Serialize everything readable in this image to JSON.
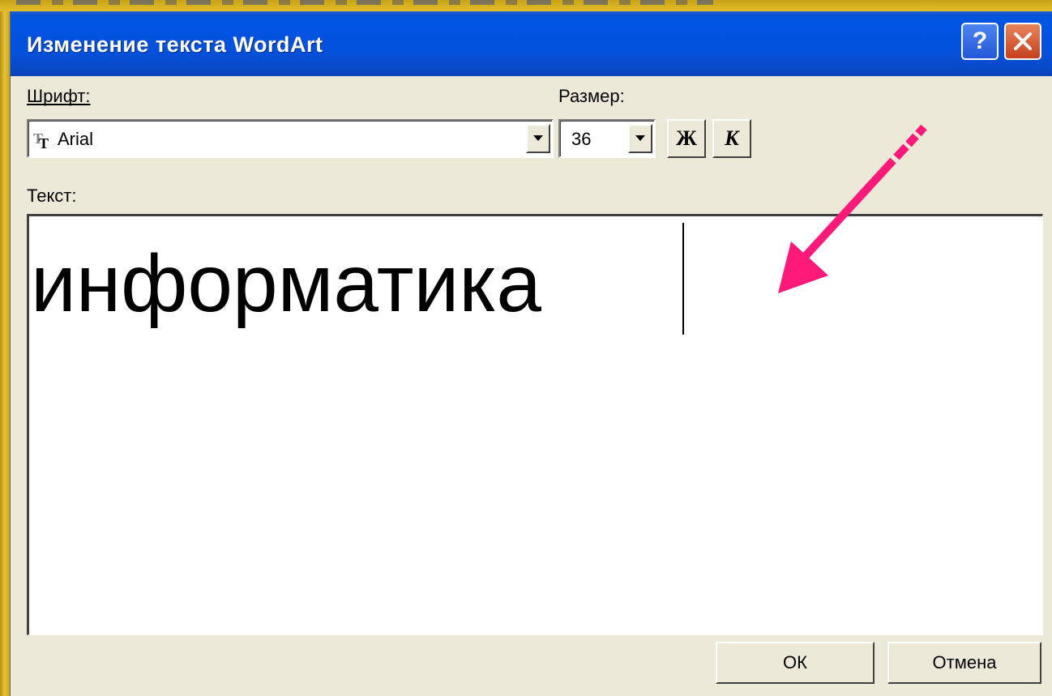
{
  "dialog": {
    "title": "Изменение текста WordArt",
    "help_button": "?",
    "close_button": "×"
  },
  "font": {
    "label": "Шрифт:",
    "value": "Arial",
    "icon": "truetype-font-icon"
  },
  "size": {
    "label": "Размер:",
    "value": "36"
  },
  "style_buttons": {
    "bold": "Ж",
    "italic": "К"
  },
  "text": {
    "label": "Текст:",
    "value": "информатика"
  },
  "buttons": {
    "ok": "ОК",
    "cancel": "Отмена"
  },
  "colors": {
    "background": "#d9b21c",
    "titlebar": "#0054e3",
    "dialog": "#ece9d8",
    "arrow": "#ff1a7a"
  }
}
